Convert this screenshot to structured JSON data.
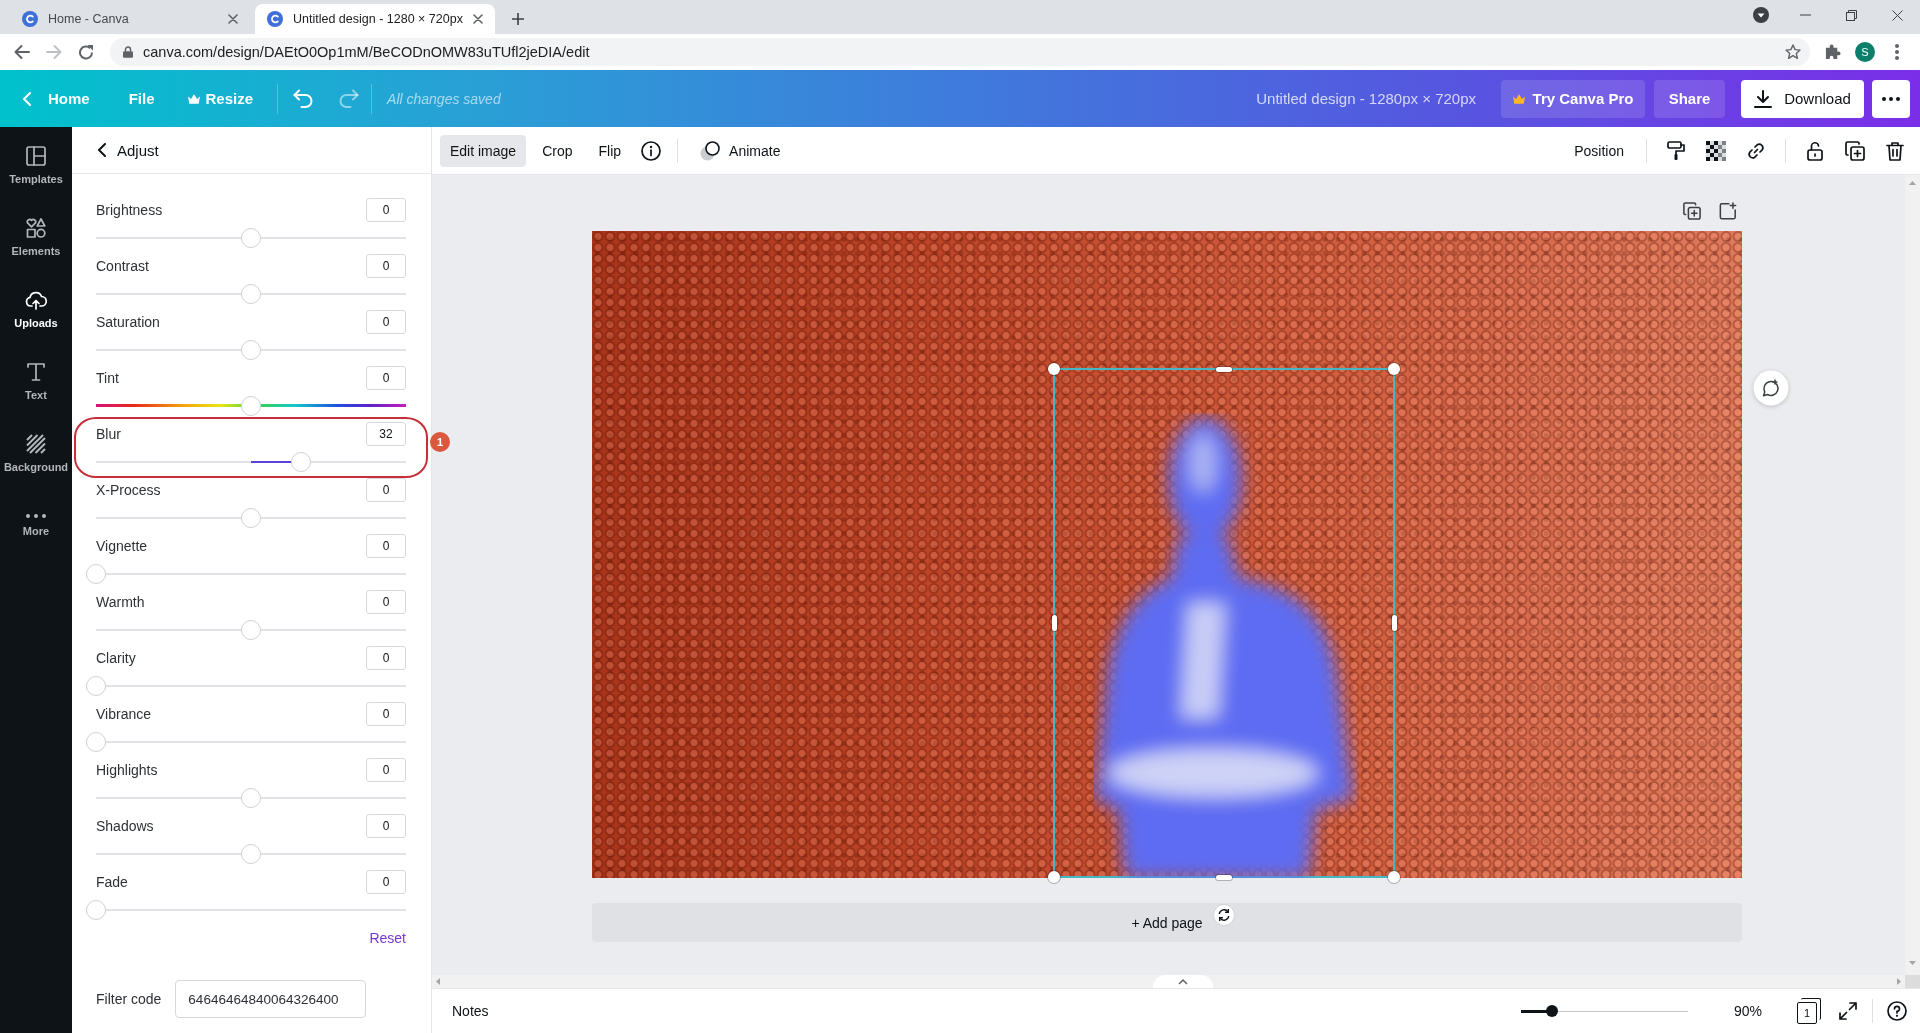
{
  "browser": {
    "tabs": [
      {
        "title": "Home - Canva",
        "selected": false
      },
      {
        "title": "Untitled design - 1280 × 720px",
        "selected": true
      }
    ],
    "url": "canva.com/design/DAEtO0Op1mM/BeCODnOMW83uTUfl2jeDIA/edit",
    "profile_initial": "S"
  },
  "header": {
    "home": "Home",
    "file": "File",
    "resize": "Resize",
    "history": [
      {
        "kind": "undo",
        "disabled": false
      },
      {
        "kind": "redo",
        "disabled": true
      }
    ],
    "save_status": "All changes saved",
    "design_title": "Untitled design - 1280px × 720px",
    "try_pro": "Try Canva Pro",
    "share": "Share",
    "download": "Download"
  },
  "sidebar": {
    "items": [
      {
        "label": "Templates",
        "selected": false
      },
      {
        "label": "Elements",
        "selected": false
      },
      {
        "label": "Uploads",
        "selected": true
      },
      {
        "label": "Text",
        "selected": false
      },
      {
        "label": "Background",
        "selected": false
      },
      {
        "label": "More",
        "selected": false
      }
    ]
  },
  "adjust_panel": {
    "title": "Adjust",
    "sliders": [
      {
        "label": "Brightness",
        "value": "0",
        "kind": "centered",
        "level": 0.5
      },
      {
        "label": "Contrast",
        "value": "0",
        "kind": "centered",
        "level": 0.5
      },
      {
        "label": "Saturation",
        "value": "0",
        "kind": "centered",
        "level": 0.5
      },
      {
        "label": "Tint",
        "value": "0",
        "kind": "hue",
        "level": 0.5
      },
      {
        "label": "Blur",
        "value": "32",
        "kind": "centered",
        "level": 0.66
      },
      {
        "label": "X-Process",
        "value": "0",
        "kind": "centered",
        "level": 0.5
      },
      {
        "label": "Vignette",
        "value": "0",
        "kind": "plain",
        "level": 0
      },
      {
        "label": "Warmth",
        "value": "0",
        "kind": "centered",
        "level": 0.5
      },
      {
        "label": "Clarity",
        "value": "0",
        "kind": "plain",
        "level": 0
      },
      {
        "label": "Vibrance",
        "value": "0",
        "kind": "plain",
        "level": 0
      },
      {
        "label": "Highlights",
        "value": "0",
        "kind": "centered",
        "level": 0.5
      },
      {
        "label": "Shadows",
        "value": "0",
        "kind": "centered",
        "level": 0.5
      },
      {
        "label": "Fade",
        "value": "0",
        "kind": "plain",
        "level": 0
      }
    ],
    "reset": "Reset",
    "filter_code": {
      "label": "Filter code",
      "value": "64646464840064326400"
    }
  },
  "annotation": {
    "number": "1"
  },
  "toolbar": {
    "buttons": [
      {
        "label": "Edit image",
        "selected": true
      },
      {
        "label": "Crop",
        "selected": false
      },
      {
        "label": "Flip",
        "selected": false
      }
    ],
    "animate": "Animate",
    "position": "Position"
  },
  "canvas": {
    "add_page": "+ Add page"
  },
  "bottom_bar": {
    "notes": "Notes",
    "zoom": {
      "level": 0.16,
      "reading": "90%"
    },
    "page_count": "1"
  }
}
